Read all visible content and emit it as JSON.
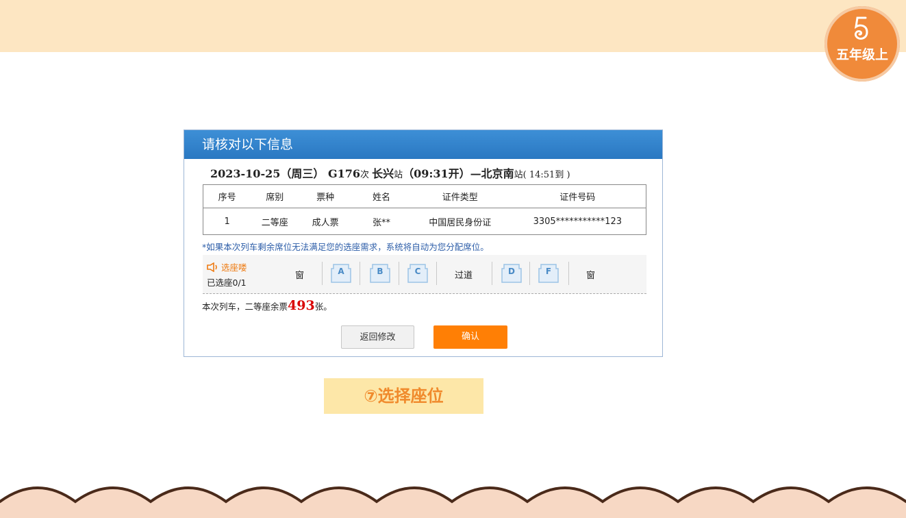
{
  "badge": {
    "grade": "五年级上",
    "icon": "number-five-swirl-icon",
    "color": "#f08a3a"
  },
  "dialog": {
    "title": "请核对以下信息",
    "trip": {
      "date": "2023-10-25（周三）",
      "train": "G176",
      "train_suffix": "次 ",
      "from": "长兴",
      "from_suffix": "站",
      "depart": "（09:31开）—",
      "to": "北京南",
      "to_suffix": "站",
      "arrive": "( 14:51到 )"
    },
    "table": {
      "headers": [
        "序号",
        "席别",
        "票种",
        "姓名",
        "证件类型",
        "证件号码"
      ],
      "rows": [
        [
          "1",
          "二等座",
          "成人票",
          "张**",
          "中国居民身份证",
          "3305***********123"
        ]
      ]
    },
    "note": "*如果本次列车剩余席位无法满足您的选座需求，系统将自动为您分配席位。",
    "seat_select": {
      "hint": "选座喽",
      "selected": "已选座0/1",
      "window_left": "窗",
      "aisle": "过道",
      "window_right": "窗",
      "seats_left": [
        "A",
        "B",
        "C"
      ],
      "seats_right": [
        "D",
        "F"
      ]
    },
    "remaining": {
      "prefix": "本次列车，二等座余票",
      "count": "493",
      "suffix": "张。"
    },
    "buttons": {
      "back": "返回修改",
      "confirm": "确认"
    }
  },
  "caption": "⑦选择座位",
  "colors": {
    "header_blue": "#2a78c2",
    "confirm_orange": "#ff7f05",
    "remaining_red": "#d90000",
    "top_band": "#fde6c2"
  }
}
